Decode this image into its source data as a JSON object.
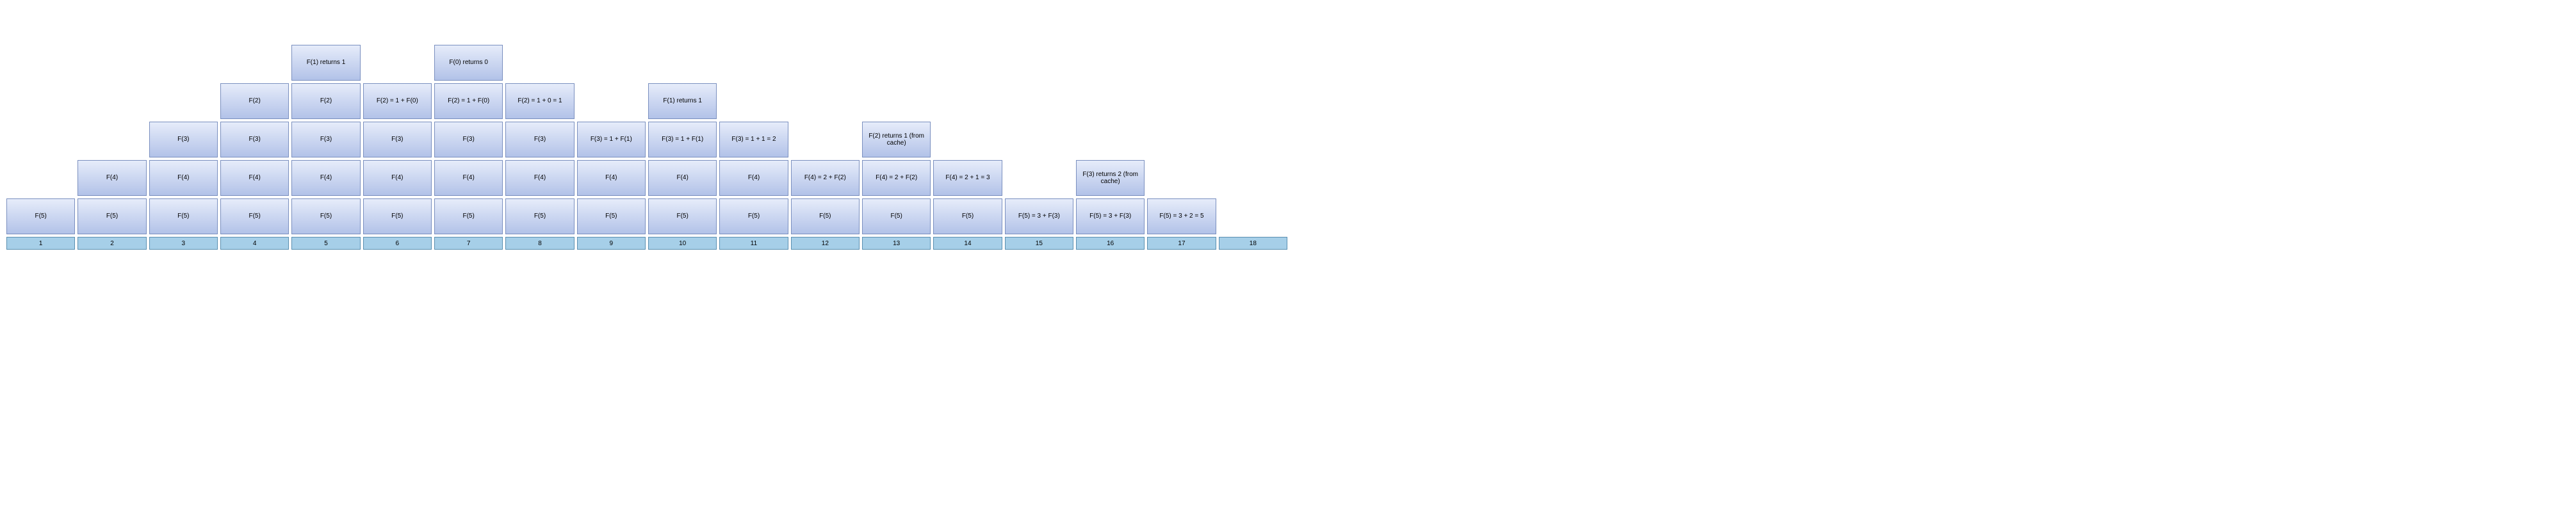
{
  "steps": [
    "1",
    "2",
    "3",
    "4",
    "5",
    "6",
    "7",
    "8",
    "9",
    "10",
    "11",
    "12",
    "13",
    "14",
    "15",
    "16",
    "17",
    "18"
  ],
  "columns": [
    {
      "col": 1,
      "stack": [
        "F(5)"
      ]
    },
    {
      "col": 2,
      "stack": [
        "F(5)",
        "F(4)"
      ]
    },
    {
      "col": 3,
      "stack": [
        "F(5)",
        "F(4)",
        "F(3)"
      ]
    },
    {
      "col": 4,
      "stack": [
        "F(5)",
        "F(4)",
        "F(3)",
        "F(2)"
      ]
    },
    {
      "col": 5,
      "stack": [
        "F(5)",
        "F(4)",
        "F(3)",
        "F(2)",
        "F(1) returns 1"
      ]
    },
    {
      "col": 6,
      "stack": [
        "F(5)",
        "F(4)",
        "F(3)",
        "F(2) = 1 + F(0)"
      ]
    },
    {
      "col": 7,
      "stack": [
        "F(5)",
        "F(4)",
        "F(3)",
        "F(2) = 1 + F(0)",
        "F(0) returns 0"
      ]
    },
    {
      "col": 8,
      "stack": [
        "F(5)",
        "F(4)",
        "F(3)",
        "F(2) = 1 + 0 = 1"
      ]
    },
    {
      "col": 9,
      "stack": [
        "F(5)",
        "F(4)",
        "F(3) = 1 + F(1)"
      ]
    },
    {
      "col": 10,
      "stack": [
        "F(5)",
        "F(4)",
        "F(3) = 1 + F(1)",
        "F(1) returns 1"
      ]
    },
    {
      "col": 11,
      "stack": [
        "F(5)",
        "F(4)",
        "F(3) = 1 + 1 = 2"
      ]
    },
    {
      "col": 12,
      "stack": [
        "F(5)",
        "F(4) = 2 + F(2)"
      ]
    },
    {
      "col": 13,
      "stack": [
        "F(5)",
        "F(4) = 2 + F(2)",
        "F(2) returns 1 (from cache)"
      ]
    },
    {
      "col": 14,
      "stack": [
        "F(5)",
        "F(4) = 2 + 1 = 3"
      ]
    },
    {
      "col": 15,
      "stack": [
        "F(5) = 3 + F(3)"
      ]
    },
    {
      "col": 16,
      "stack": [
        "F(5) = 3 + F(3)",
        "F(3) returns 2 (from cache)"
      ]
    },
    {
      "col": 17,
      "stack": [
        "F(5) = 3 + 2 = 5"
      ]
    },
    {
      "col": 18,
      "stack": []
    }
  ]
}
